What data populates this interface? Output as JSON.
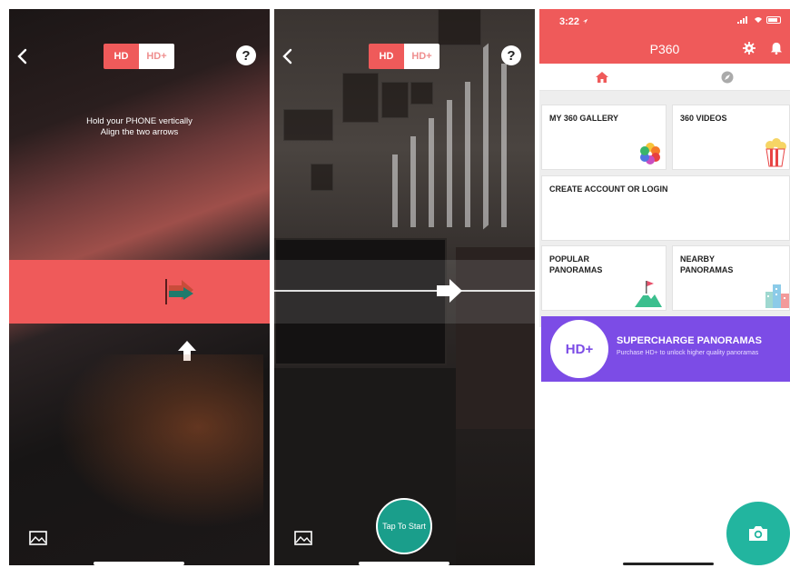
{
  "screens": [
    {
      "hd_label": "HD",
      "hdplus_label": "HD+",
      "help_label": "?",
      "hint_line1": "Hold your PHONE vertically",
      "hint_line2": "Align the two arrows"
    },
    {
      "hd_label": "HD",
      "hdplus_label": "HD+",
      "help_label": "?",
      "start_button": "Tap To Start"
    }
  ],
  "app": {
    "status_time": "3:22",
    "title": "P360",
    "tiles": {
      "gallery": "MY 360 GALLERY",
      "videos": "360 VIDEOS",
      "account": "CREATE ACCOUNT OR LOGIN",
      "popular": "POPULAR PANORAMAS",
      "nearby": "NEARBY PANORAMAS"
    },
    "promo": {
      "badge": "HD+",
      "title": "SUPERCHARGE PANORAMAS",
      "subtitle": "Purchase HD+ to unlock higher quality panoramas"
    }
  },
  "colors": {
    "accent": "#ef5a5a",
    "teal": "#1a9e8b",
    "purple": "#7c4ce6"
  }
}
